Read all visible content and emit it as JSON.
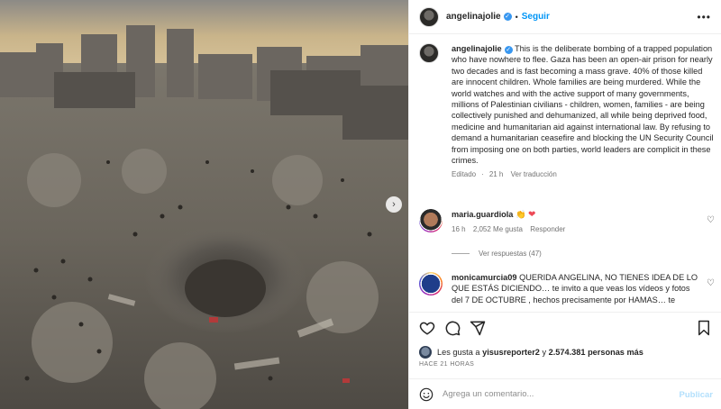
{
  "post": {
    "username": "angelinajolie",
    "follow_label": "Seguir",
    "more_icon": "more-horizontal-icon",
    "caption": "This is the deliberate bombing of a trapped population who have nowhere to flee. Gaza has been an open-air prison for nearly two decades and is fast becoming a mass grave. 40% of those killed are innocent children. Whole families are being murdered. While the world watches and with the active support of many governments, millions of Palestinian civilians - children, women, families - are being collectively punished and dehumanized, all while being deprived food, medicine and humanitarian aid against international law. By refusing to demand a humanitarian ceasefire and blocking the UN Security Council from imposing one on both parties, world leaders are complicit in these crimes.",
    "edited_label": "Editado",
    "edited_time": "21 h",
    "translation_label": "Ver traducción"
  },
  "comments": [
    {
      "username": "maria.guardiola",
      "text": "👏",
      "time": "16 h",
      "likes": "2,052 Me gusta",
      "reply_label": "Responder",
      "view_replies": "Ver respuestas (47)"
    },
    {
      "username": "monicamurcia09",
      "text": "QUERIDA ANGELINA, NO TIENES IDEA DE LO QUE ESTÁS DICIENDO… te invito a que veas los vídeos y fotos del 7 DE OCTUBRE , hechos precisamente por HAMAS… te"
    }
  ],
  "actions": {
    "like_icon": "heart-icon",
    "comment_icon": "comment-icon",
    "share_icon": "send-icon",
    "save_icon": "bookmark-icon"
  },
  "likes": {
    "prefix": "Les gusta a",
    "user": "yisusreporter2",
    "connector": "y",
    "count": "2.574.381 personas más"
  },
  "timestamp": "HACE 21 HORAS",
  "composer": {
    "placeholder": "Agrega un comentario...",
    "publish_label": "Publicar"
  },
  "colors": {
    "accent": "#0095f6",
    "verified": "#3897f0",
    "heart": "#ed4956",
    "muted": "#737373"
  }
}
